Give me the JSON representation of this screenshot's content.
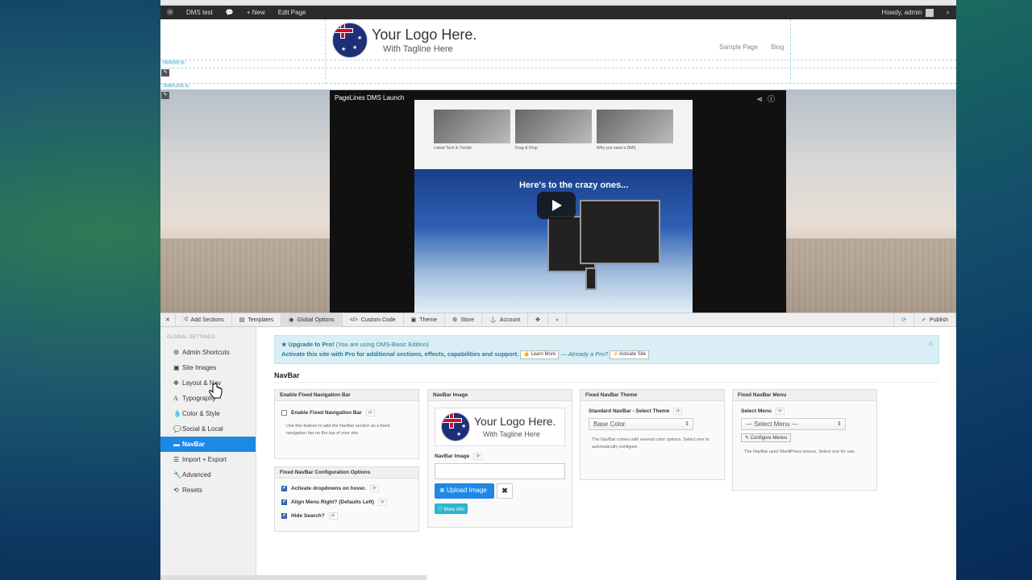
{
  "wp_bar": {
    "wp_logo_icon": "wordpress-icon",
    "site_name": "DMS test",
    "comments_icon": "comment-icon",
    "new_label": "New",
    "edit_page": "Edit Page",
    "greeting": "Howdy, admin",
    "search_icon": "search-icon"
  },
  "header": {
    "logo_title": "Your Logo Here.",
    "logo_tagline": "With Tagline Here",
    "nav": [
      "Sample Page",
      "Blog"
    ],
    "header_tag": "HEADER",
    "template_tag": "TEMPLATE"
  },
  "video": {
    "title": "PageLines DMS Launch",
    "captions": [
      "Latest Tech & Trends",
      "Drag & Drop",
      "Why you need a DMS"
    ],
    "banner": "Here's to the crazy ones..."
  },
  "toolbar": {
    "close_icon": "close-icon",
    "items": [
      {
        "label": "Add Sections",
        "icon": "shuffle-icon"
      },
      {
        "label": "Templates",
        "icon": "document-icon"
      },
      {
        "label": "Global Options",
        "icon": "globe-icon"
      },
      {
        "label": "Custom Code",
        "icon": "code-icon"
      },
      {
        "label": "Theme",
        "icon": "image-icon"
      },
      {
        "label": "Store",
        "icon": "cogs-icon"
      },
      {
        "label": "Account",
        "icon": "anchor-icon"
      }
    ],
    "publish": "Publish"
  },
  "sidebar": {
    "heading": "GLOBAL SETTINGS",
    "items": [
      {
        "label": "Admin Shortcuts",
        "icon": "gear-icon"
      },
      {
        "label": "Site Images",
        "icon": "picture-icon"
      },
      {
        "label": "Layout & Nav",
        "icon": "move-icon"
      },
      {
        "label": "Typography",
        "icon": "font-icon"
      },
      {
        "label": "Color & Style",
        "icon": "tint-icon"
      },
      {
        "label": "Social & Local",
        "icon": "comments-icon"
      },
      {
        "label": "NavBar",
        "icon": "navbar-icon"
      },
      {
        "label": "Import + Export",
        "icon": "list-icon"
      },
      {
        "label": "Advanced",
        "icon": "wrench-icon"
      },
      {
        "label": "Resets",
        "icon": "refresh-icon"
      }
    ],
    "active_index": 6
  },
  "alert": {
    "line1_strong": "★ Upgrade to Pro!",
    "line1_rest": "(You are using DMS-Basic Edition)",
    "line2": "Activate this site with Pro for additional sections, effects, capabilities and support.",
    "learn_more": "Learn More",
    "already_pro": "— Already a Pro?",
    "activate": "Activate Site"
  },
  "section_title": "NavBar",
  "panels": {
    "enable_fixed": {
      "title": "Enable Fixed Navigation Bar",
      "option": "Enable Fixed Navigation Bar",
      "checked": false,
      "help": "Use this feature to add the NavBar section as a fixed navigation bar on the top of your site."
    },
    "config": {
      "title": "Fixed NavBar Configuration Options",
      "options": [
        {
          "label": "Activate dropdowns on hover.",
          "checked": true
        },
        {
          "label": "Align Menu Right? (Defaults Left)",
          "checked": true
        },
        {
          "label": "Hide Search?",
          "checked": true
        }
      ]
    },
    "image": {
      "title": "NavBar Image",
      "logo_title": "Your Logo Here.",
      "logo_tagline": "With Tagline Here",
      "field_label": "NavBar Image",
      "upload": "Upload Image",
      "remove": "✖",
      "more_info": "More Info"
    },
    "theme": {
      "title": "Fixed NavBar Theme",
      "field_label": "Standard NavBar - Select Theme",
      "value": "Base Color",
      "help": "The NavBar comes with several color options. Select one to automatically configure."
    },
    "menu": {
      "title": "Fixed NavBar Menu",
      "field_label": "Select Menu",
      "value": "— Select Menu —",
      "configure": "Configure Menus",
      "help": "The NavBar uses WordPress menus. Select one for use."
    }
  }
}
